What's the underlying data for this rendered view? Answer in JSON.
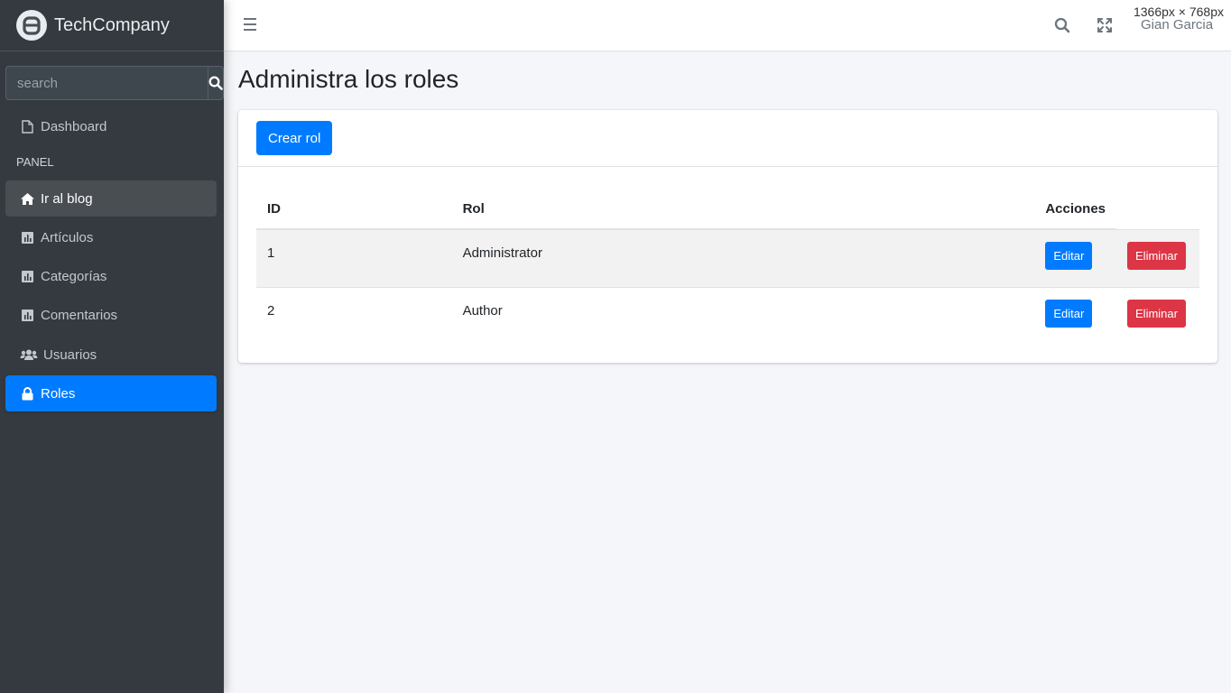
{
  "brand": {
    "name_bold": "Tech",
    "name_light": "Company"
  },
  "sidebar": {
    "search_placeholder": "search",
    "dashboard_label": "Dashboard",
    "panel_header": "PANEL",
    "items": [
      {
        "label": "Ir al blog",
        "icon": "home-icon"
      },
      {
        "label": "Artículos",
        "icon": "chart-bar-icon"
      },
      {
        "label": "Categorías",
        "icon": "chart-bar-icon"
      },
      {
        "label": "Comentarios",
        "icon": "chart-bar-icon"
      },
      {
        "label": "Usuarios",
        "icon": "users-icon"
      },
      {
        "label": "Roles",
        "icon": "lock-icon"
      }
    ]
  },
  "topbar": {
    "user_name": "Gian Garcia",
    "screen_dims": "1366px × 768px"
  },
  "page": {
    "title": "Administra los roles",
    "create_button": "Crear rol"
  },
  "table": {
    "headers": {
      "id": "ID",
      "role": "Rol",
      "actions": "Acciones"
    },
    "rows": [
      {
        "id": "1",
        "role": "Administrator",
        "edit": "Editar",
        "delete": "Eliminar"
      },
      {
        "id": "2",
        "role": "Author",
        "edit": "Editar",
        "delete": "Eliminar"
      }
    ]
  },
  "colors": {
    "sidebar_bg": "#343a40",
    "accent": "#007bff",
    "danger": "#dc3545",
    "content_bg": "#f4f6f9"
  }
}
